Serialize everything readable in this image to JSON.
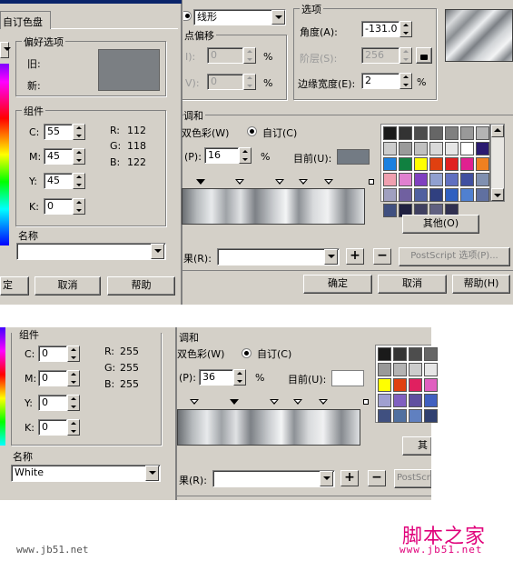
{
  "top_left": {
    "tab_label": "自订色盘",
    "prefs_title": "偏好选项",
    "old_label": "旧:",
    "new_label": "新:",
    "components_title": "组件",
    "c_label": "C:",
    "c_value": "55",
    "m_label": "M:",
    "m_value": "45",
    "y_label": "Y:",
    "y_value": "45",
    "k_label": "K:",
    "k_value": "0",
    "r_label": "R:",
    "r_value": "112",
    "g_label": "G:",
    "g_value": "118",
    "b_label": "B:",
    "b_value": "122",
    "name_label": "名称",
    "name_value": "",
    "ok_label": "定",
    "cancel_label": "取消",
    "help_label": "帮助",
    "swatch_color": "#7b7f83"
  },
  "top_right": {
    "type_value": "线形",
    "center_offset_title": "点偏移",
    "h_value": "0",
    "v_value": "0",
    "pct": "%",
    "options_title": "选项",
    "angle_label": "角度(A):",
    "angle_value": "-131.0",
    "steps_label": "阶层(S):",
    "steps_value": "256",
    "edge_label": "边缘宽度(E):",
    "edge_value": "2",
    "blend_title": "调和",
    "two_color_label": "双色彩(W)",
    "custom_label": "自订(C)",
    "position_label": "(P):",
    "position_value": "16",
    "current_label": "目前(U):",
    "current_color": "#737b84",
    "other_label": "其他(O)",
    "presets_label": "果(R):",
    "postscript_label": "PostScript 选项(P)...",
    "ok_label": "确定",
    "cancel_label": "取消",
    "help_label": "帮助(H)"
  },
  "bottom": {
    "components_title": "组件",
    "c_label": "C:",
    "c_value": "0",
    "m_label": "M:",
    "m_value": "0",
    "y_label": "Y:",
    "y_value": "0",
    "k_label": "K:",
    "k_value": "0",
    "r_label": "R:",
    "r_value": "255",
    "g_label": "G:",
    "g_value": "255",
    "b_label": "B:",
    "b_value": "255",
    "name_label": "名称",
    "name_value": "White",
    "blend_title": "调和",
    "two_color_label": "双色彩(W)",
    "custom_label": "自订(C)",
    "position_label": "(P):",
    "position_value": "36",
    "pct": "%",
    "current_label": "目前(U):",
    "current_color": "#ffffff",
    "other_label": "其",
    "presets_label": "果(R):",
    "postscript_label": "PostScr"
  },
  "watermark": {
    "site_left": "www.jb51.net",
    "logo_text": "脚本之家",
    "logo_url": "www.jb51.net"
  },
  "palette_top": [
    "#1a1a1a",
    "#333333",
    "#4d4d4d",
    "#666666",
    "#808080",
    "#999999",
    "#b3b3b3",
    "#cccccc",
    "#9a9a9a",
    "#c0c0c0",
    "#d9d9d9",
    "#e6e6e6",
    "#ffffff",
    "#2a1a70",
    "#1a80e0",
    "#108040",
    "#ffff00",
    "#e04010",
    "#e02020",
    "#e02090",
    "#f08020",
    "#f0a0b0",
    "#e080d0",
    "#8040c0",
    "#90a0d0",
    "#6070c0",
    "#4050a0",
    "#8090b0",
    "#a0a0c0",
    "#7060a0",
    "#5060a0",
    "#304080",
    "#3060c0",
    "#5080d0",
    "#6070a0",
    "#405080",
    "#202040",
    "#404060",
    "#606080",
    "#303050"
  ],
  "palette_bottom": [
    "#1a1a1a",
    "#333333",
    "#4d4d4d",
    "#666666",
    "#999999",
    "#b3b3b3",
    "#cccccc",
    "#e6e6e6",
    "#ffff00",
    "#e04010",
    "#e02060",
    "#e060c0",
    "#a0a0d0",
    "#8060c0",
    "#6050a0",
    "#4060c0",
    "#405080",
    "#5070a0",
    "#6080c0",
    "#304070"
  ]
}
